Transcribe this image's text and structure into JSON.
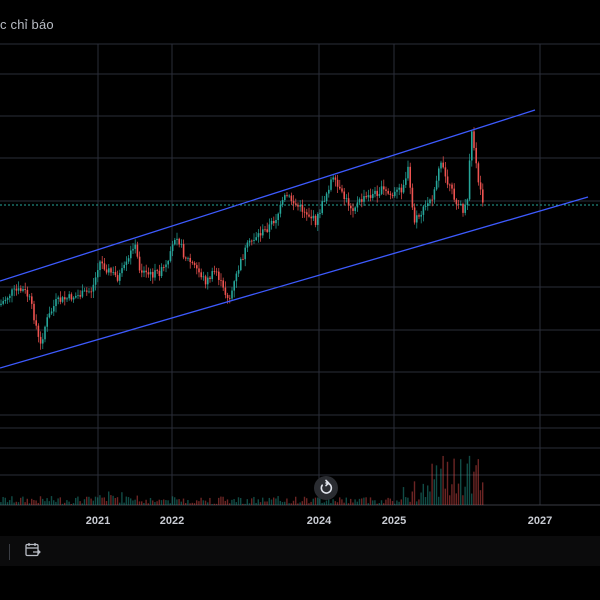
{
  "toolbar": {
    "indicator_label": "c chỉ báo"
  },
  "time_axis": {
    "labels": [
      "2021",
      "2022",
      "2024",
      "2025",
      "2027"
    ]
  },
  "controls": {
    "reset_icon": "reset-rotate-icon",
    "date_range_icon": "calendar-range-icon"
  },
  "colors": {
    "up": "#26a69a",
    "down": "#ef5350",
    "channel": "#3d5afe",
    "reference_line": "#26a69a",
    "grid": "#2a2e39",
    "background": "#000000"
  }
}
